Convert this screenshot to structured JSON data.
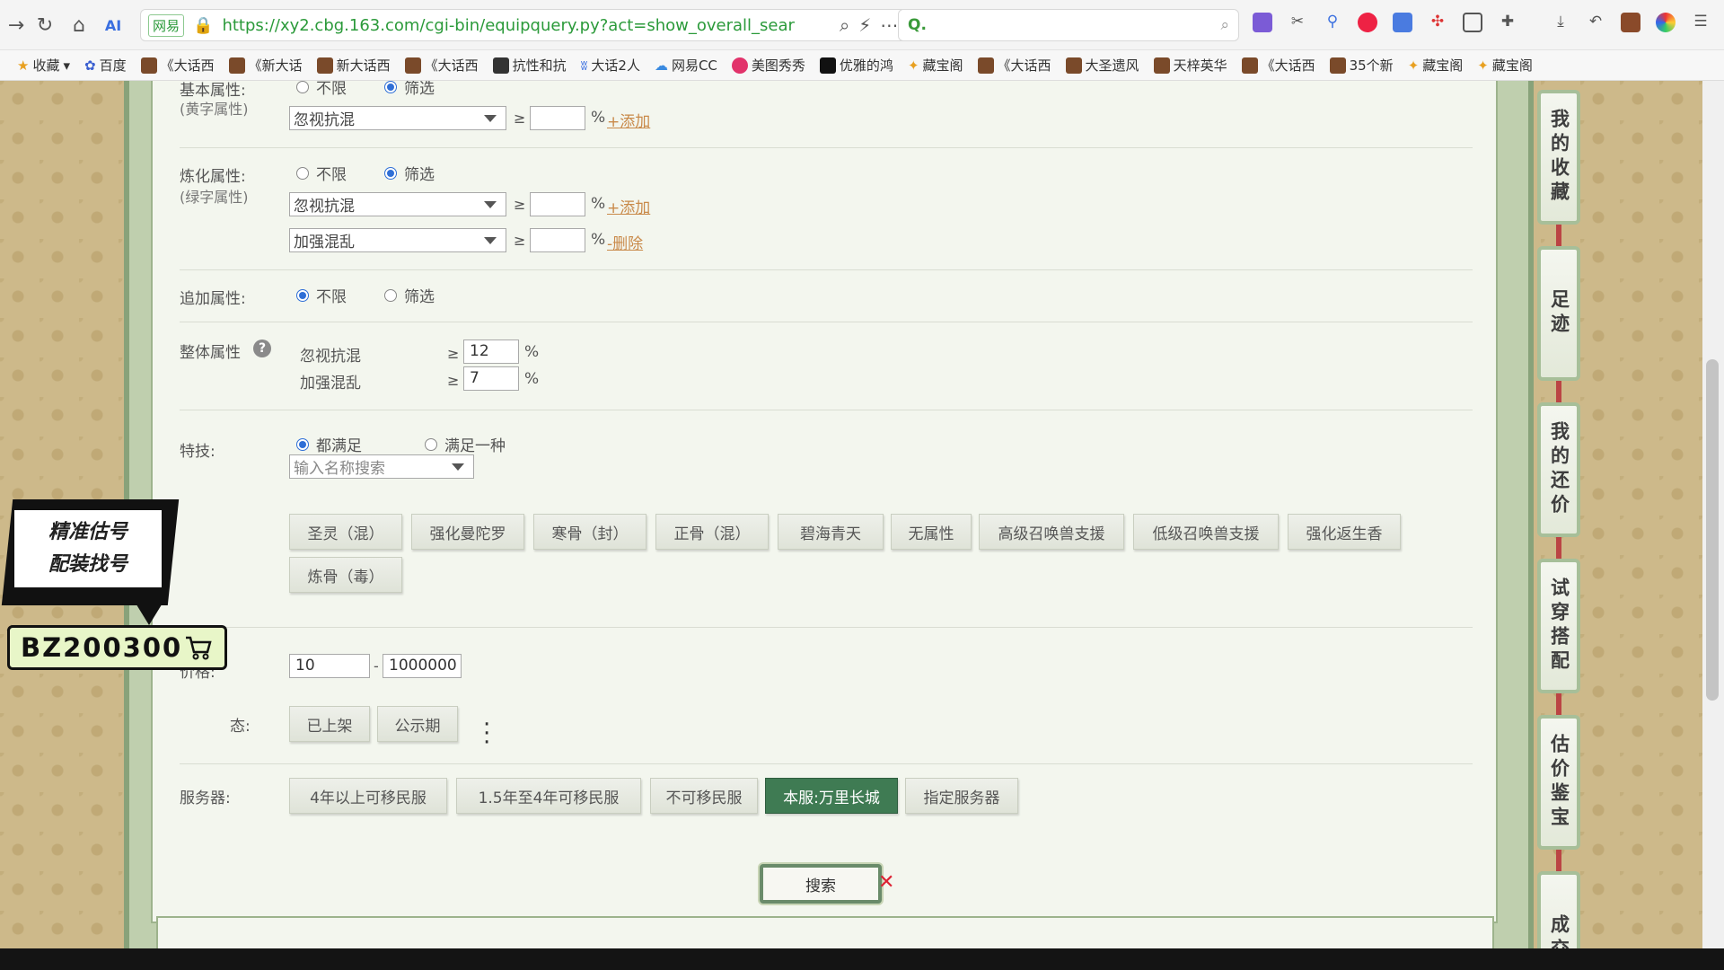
{
  "browser": {
    "url": "https://xy2.cbg.163.com/cgi-bin/equipquery.py?act=show_overall_sear",
    "site_badge": "网易",
    "search_placeholder": "Q.",
    "bookmarks": [
      "收藏",
      "百度",
      "《大话西",
      "《新大话",
      "新大话西",
      "《大话西",
      "抗性和抗",
      "大话2人",
      "网易CC",
      "美图秀秀",
      "优雅的鸿",
      "藏宝阁",
      "《大话西",
      "大圣遗风",
      "天梓英华",
      "《大话西",
      "35个新",
      "藏宝阁",
      "藏宝阁"
    ]
  },
  "form": {
    "basic": {
      "label": "基本属性:",
      "sublabel": "(黄字属性)",
      "opt_any": "不限",
      "opt_filter": "筛选",
      "select_value": "忽视抗混",
      "ge": "≥",
      "pct": "%",
      "add_link": "+添加"
    },
    "refine": {
      "label": "炼化属性:",
      "sublabel": "(绿字属性)",
      "opt_any": "不限",
      "opt_filter": "筛选",
      "select1_value": "忽视抗混",
      "select2_value": "加强混乱",
      "ge": "≥",
      "pct": "%",
      "add_link": "+添加",
      "delete_link": "-删除"
    },
    "extra": {
      "label": "追加属性:",
      "opt_any": "不限",
      "opt_filter": "筛选"
    },
    "overall": {
      "label": "整体属性",
      "help": "?",
      "rows": [
        {
          "name": "忽视抗混",
          "ge": "≥",
          "value": "12",
          "pct": "%"
        },
        {
          "name": "加强混乱",
          "ge": "≥",
          "value": "7",
          "pct": "%"
        }
      ]
    },
    "skill": {
      "label": "特技:",
      "opt_all": "都满足",
      "opt_one": "满足一种",
      "search_placeholder": "输入名称搜索",
      "tags": [
        "圣灵（混）",
        "强化曼陀罗",
        "寒骨（封）",
        "正骨（混）",
        "碧海青天",
        "无属性",
        "高级召唤兽支援",
        "低级召唤兽支援",
        "强化返生香",
        "炼骨（毒）"
      ]
    },
    "price": {
      "label": "价格:",
      "min": "10",
      "sep": "-",
      "max": "1000000"
    },
    "status": {
      "label_partial": "态:",
      "buttons": [
        "已上架",
        "公示期"
      ]
    },
    "server": {
      "label": "服务器:",
      "buttons": [
        "4年以上可移民服",
        "1.5年至4年可移民服",
        "不可移民服",
        "本服:万里长城",
        "指定服务器"
      ],
      "active": "本服:万里长城"
    },
    "search_button": "搜索"
  },
  "side_nav": [
    "我的收藏",
    "足迹",
    "我的还价",
    "试穿搭配",
    "估价鉴宝",
    "成交"
  ],
  "promo": {
    "line1": "精准估号",
    "line2": "配装找号",
    "code": "BZ200300"
  },
  "colors": {
    "active_green": "#3f7b53",
    "link": "#c98a4a",
    "url_green": "#2b9a3a"
  }
}
